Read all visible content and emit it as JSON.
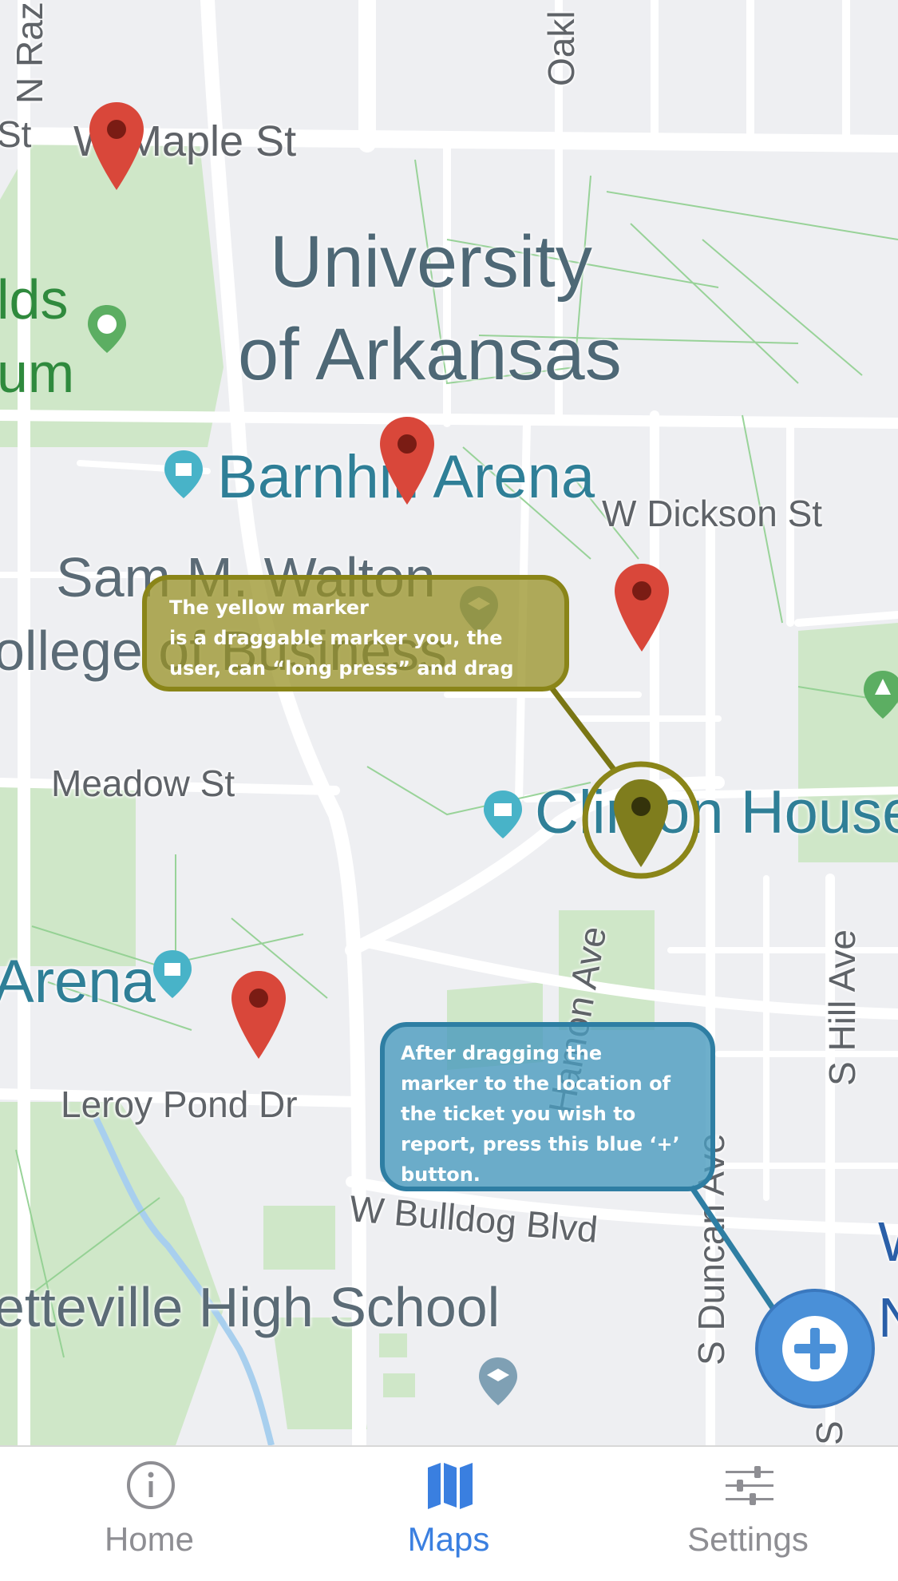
{
  "map": {
    "road_labels": {
      "n_raz": "N Raz",
      "st_left": "St",
      "w_maple_st": "W Maple St",
      "oakl": "Oakl",
      "w_dickson_st": "W Dickson St",
      "meadow_st": "Meadow St",
      "hamon_ave": "Hamon Ave",
      "s_hill_ave": "S Hill Ave",
      "leroy_pond_dr": "Leroy Pond Dr",
      "w_bulldog_blvd": "W Bulldog Blvd",
      "s_duncan_ave": "S Duncan Ave",
      "s_edge": "S",
      "right_edge_top": "W",
      "right_edge_bottom": "N"
    },
    "place_labels": {
      "university_line1": "University",
      "university_line2": "of Arkansas",
      "barnhill_arena": "Barnhill Arena",
      "sam_walton_line1": "Sam M. Walton",
      "sam_walton_line2": "ollege of Business",
      "clinton_house": "Clinton House",
      "arena_left": "Arena",
      "high_school": "etteville High School",
      "fields_line1": "lds",
      "fields_line2": "um"
    }
  },
  "callouts": {
    "yellow": {
      "lines": [
        "The yellow marker",
        "is a draggable marker you, the",
        "user, can “long press” and drag"
      ]
    },
    "blue": {
      "lines": [
        "After dragging the",
        "marker to the location of",
        "the ticket you wish to",
        "report, press this blue ‘+’",
        "button."
      ]
    }
  },
  "colors": {
    "red_marker": "#d9473a",
    "yellow_marker": "#7f7d1d",
    "fab_blue": "#4a90d8",
    "tab_active": "#3a7fe0",
    "tab_inactive": "#8e8e93"
  },
  "tabs": [
    {
      "label": "Home",
      "icon": "info-icon",
      "active": false
    },
    {
      "label": "Maps",
      "icon": "map-icon",
      "active": true
    },
    {
      "label": "Settings",
      "icon": "sliders-icon",
      "active": false
    }
  ]
}
